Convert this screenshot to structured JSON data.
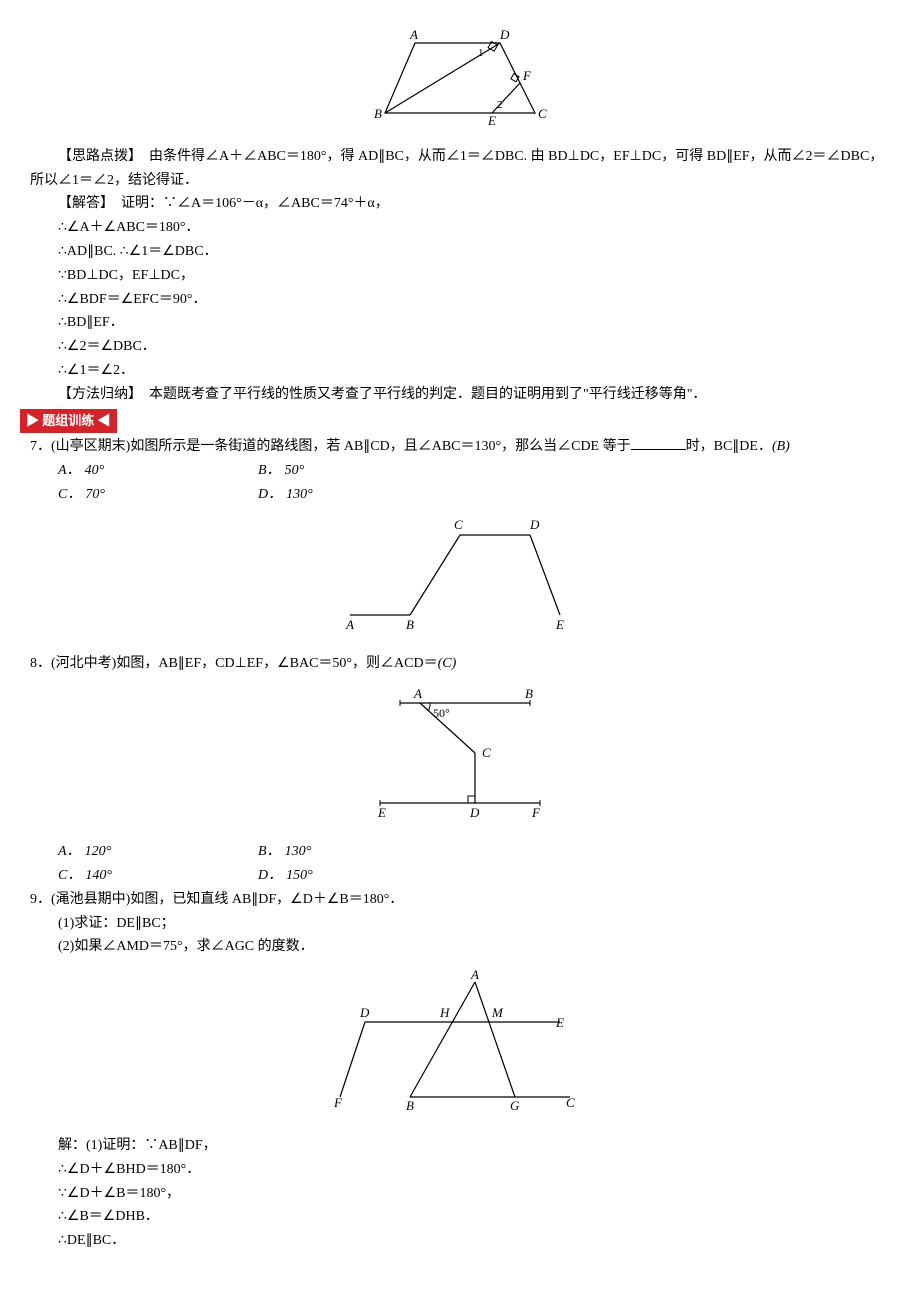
{
  "topFig": {
    "labels": {
      "A": "A",
      "B": "B",
      "C": "C",
      "D": "D",
      "E": "E",
      "F": "F",
      "one": "1",
      "two": "2"
    }
  },
  "thought": {
    "label": "【思路点拨】",
    "text": "　由条件得∠A＋∠ABC＝180°，得 AD∥BC，从而∠1＝∠DBC. 由 BD⊥DC，EF⊥DC，可得 BD∥EF，从而∠2＝∠DBC，所以∠1＝∠2，结论得证．"
  },
  "solve": {
    "label": "【解答】",
    "lead": "　证明：∵∠A＝106°－α，∠ABC＝74°＋α，",
    "l1": "∴∠A＋∠ABC＝180°．",
    "l2": "∴AD∥BC. ∴∠1＝∠DBC．",
    "l3": "∵BD⊥DC，EF⊥DC，",
    "l4": "∴∠BDF＝∠EFC＝90°．",
    "l5": "∴BD∥EF．",
    "l6": "∴∠2＝∠DBC．",
    "l7": "∴∠1＝∠2．"
  },
  "method": {
    "label": "【方法归纳】",
    "text": "　本题既考查了平行线的性质又考查了平行线的判定．题目的证明用到了\"平行线迁移等角\"．"
  },
  "banner": {
    "left": "▶",
    "text": "题组训练",
    "right": "◀"
  },
  "q7": {
    "num": "7．",
    "src": "(山亭区期末)",
    "stem": "如图所示是一条街道的路线图，若 AB∥CD，且∠ABC＝130°，那么当∠CDE 等于",
    "tail": "时，BC∥DE．",
    "ans": "(B)",
    "opts": {
      "A": "40°",
      "B": "50°",
      "C": "70°",
      "D": "130°"
    },
    "labels": {
      "A": "A",
      "B": "B",
      "C": "C",
      "D": "D",
      "E": "E"
    }
  },
  "q8": {
    "num": "8．",
    "src": "(河北中考)",
    "stem": "如图，AB∥EF，CD⊥EF，∠BAC＝50°，则∠ACD＝",
    "ans": "(C)",
    "opts": {
      "A": "120°",
      "B": "130°",
      "C": "140°",
      "D": "150°"
    },
    "labels": {
      "A": "A",
      "B": "B",
      "C": "C",
      "D": "D",
      "E": "E",
      "F": "F",
      "fifty": "50°"
    }
  },
  "q9": {
    "num": "9．",
    "src": "(渑池县期中)",
    "stem": "如图，已知直线 AB∥DF，∠D＋∠B＝180°．",
    "p1": "(1)求证：DE∥BC；",
    "p2": "(2)如果∠AMD＝75°，求∠AGC 的度数．",
    "labels": {
      "A": "A",
      "B": "B",
      "C": "C",
      "D": "D",
      "E": "E",
      "F": "F",
      "G": "G",
      "H": "H",
      "M": "M"
    },
    "sol": {
      "lead": "解：(1)证明：∵AB∥DF，",
      "l1": "∴∠D＋∠BHD＝180°．",
      "l2": "∵∠D＋∠B＝180°，",
      "l3": "∴∠B＝∠DHB．",
      "l4": "∴DE∥BC．"
    }
  }
}
